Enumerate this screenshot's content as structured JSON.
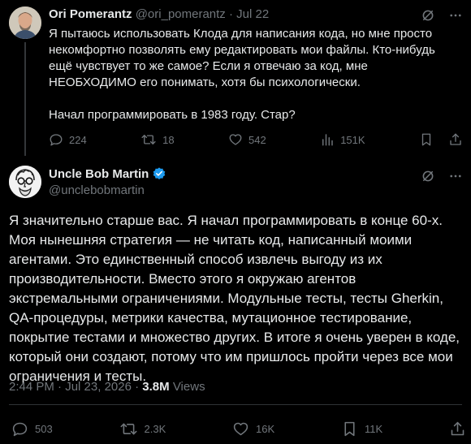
{
  "parent_tweet": {
    "author_name": "Ori Pomerantz",
    "author_handle": "@ori_pomerantz",
    "separator": "·",
    "date": "Jul 22",
    "text_paragraph_1": "Я пытаюсь использовать Клода для написания кода, но мне просто некомфортно позволять ему редактировать мои файлы. Кто-нибудь ещё чувствует то же самое? Если я отвечаю за код, мне НЕОБХОДИМО его понимать, хотя бы психологически.",
    "text_paragraph_2": "Начал программировать в 1983 году. Стар?",
    "replies": "224",
    "reposts": "18",
    "likes": "542",
    "views": "151K"
  },
  "main_tweet": {
    "author_name": "Uncle Bob Martin",
    "author_handle": "@unclebobmartin",
    "verified": true,
    "text": "Я значительно старше вас. Я начал программировать в конце 60-х. Моя нынешняя стратегия — не читать код, написанный моими агентами. Это единственный способ извлечь выгоду из их производительности. Вместо этого я окружаю агентов экстремальными ограничениями. Модульные тесты, тесты Gherkin, QA-процедуры, метрики качества, мутационное тестирование, покрытие тестами и множество других. В итоге я очень уверен в коде, который они создают, потому что им пришлось пройти через все мои ограничения и тесты.",
    "time": "2:44 PM",
    "separator": "·",
    "date": "Jul 23, 2026",
    "views_count": "3.8M",
    "views_label": "Views",
    "replies": "503",
    "reposts": "2.3K",
    "likes": "16K",
    "bookmarks": "11K"
  },
  "colors": {
    "background": "#000000",
    "text_primary": "#e7e9ea",
    "text_secondary": "#71767b",
    "verified_badge": "#1d9bf0",
    "divider": "#2f3336"
  },
  "icons": [
    "grok-icon",
    "more-icon",
    "reply-icon",
    "repost-icon",
    "like-icon",
    "views-icon",
    "bookmark-icon",
    "share-icon",
    "verified-icon"
  ]
}
